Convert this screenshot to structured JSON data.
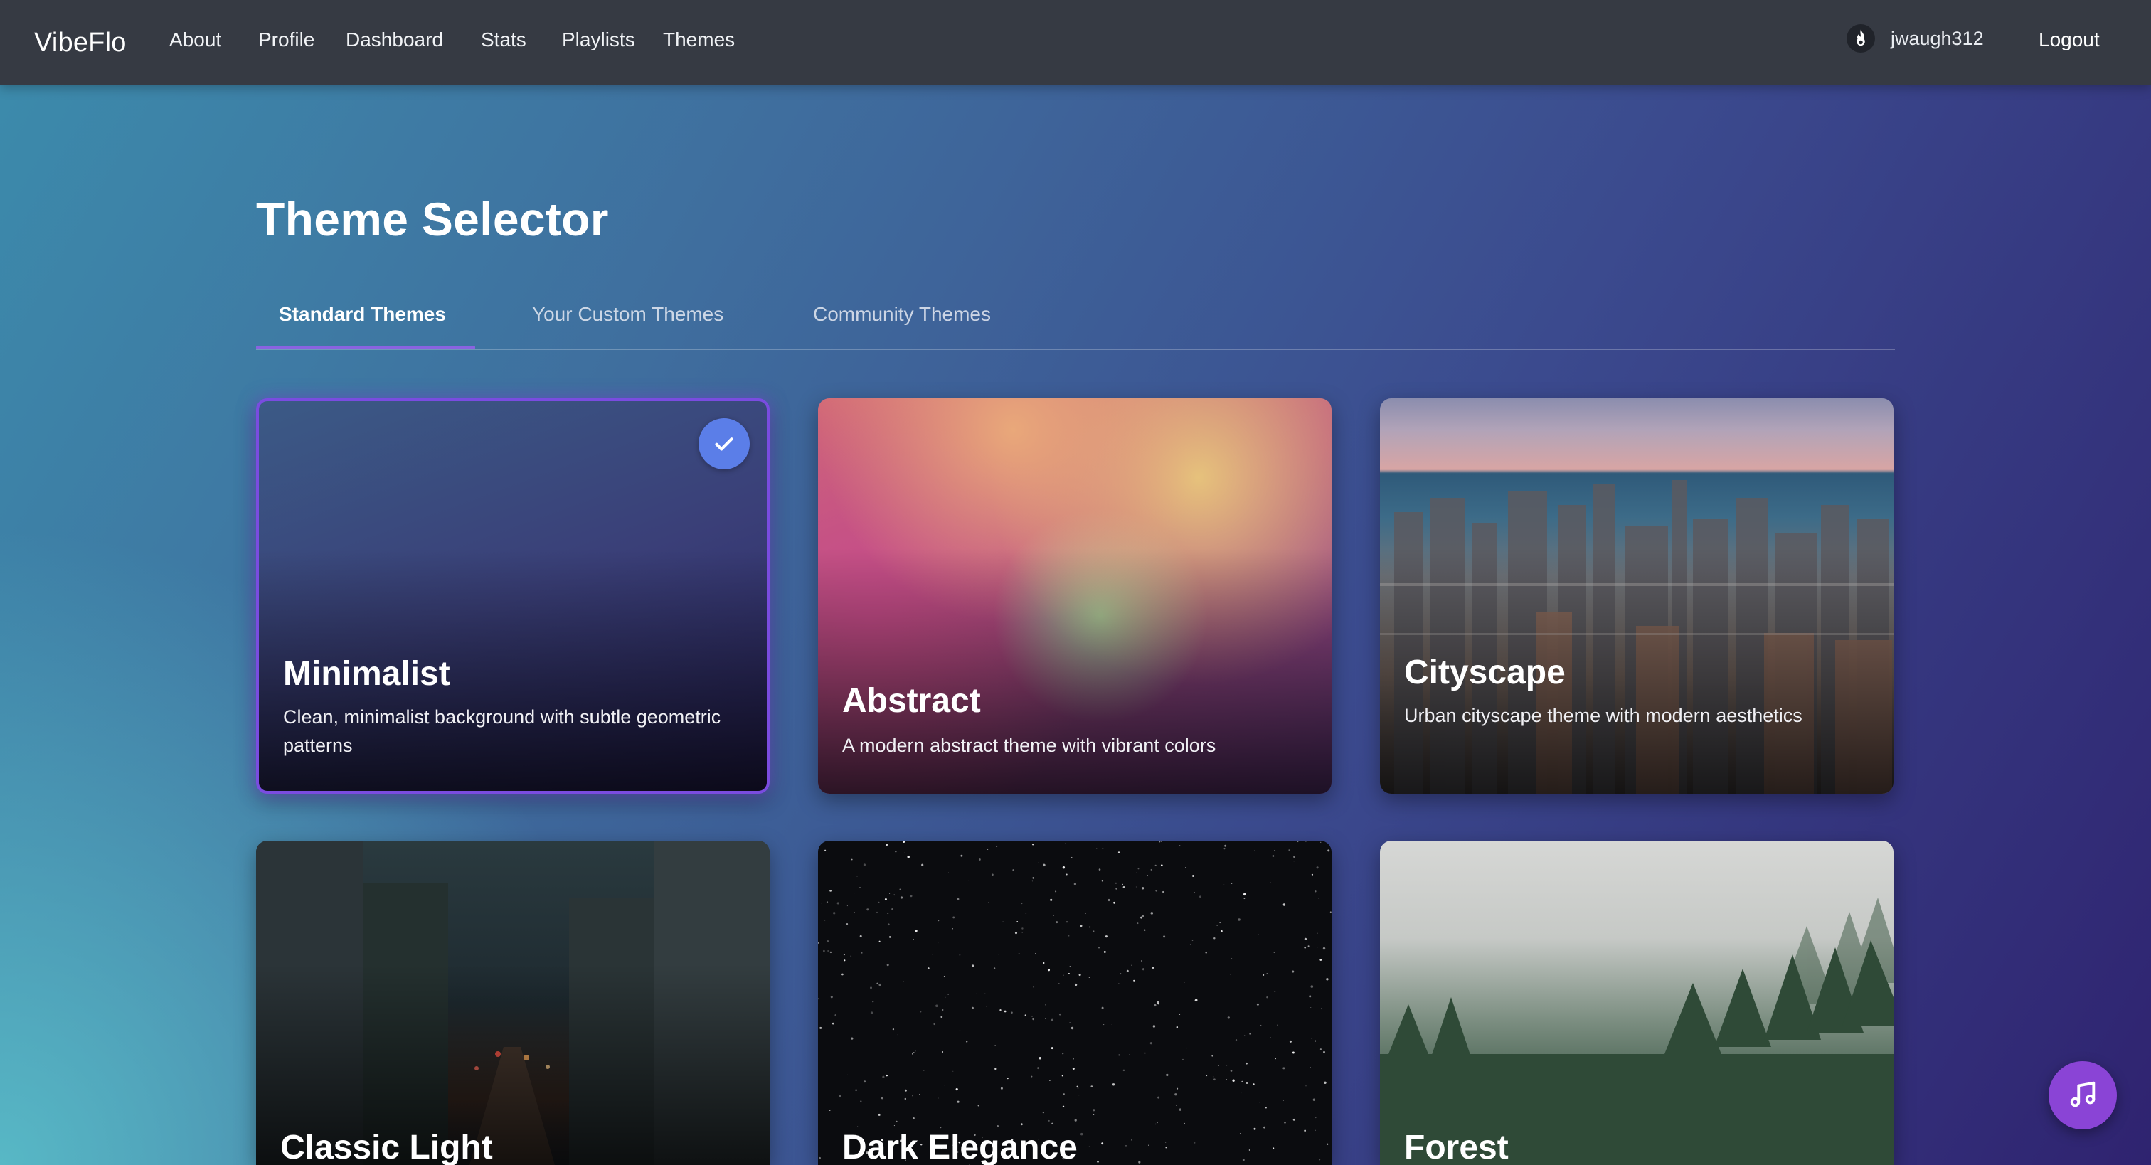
{
  "nav": {
    "brand": "VibeFlo",
    "links": [
      "About",
      "Profile",
      "Dashboard",
      "Stats",
      "Playlists",
      "Themes"
    ],
    "username": "jwaugh312",
    "logout": "Logout"
  },
  "page": {
    "title": "Theme Selector",
    "tabs": [
      "Standard Themes",
      "Your Custom Themes",
      "Community Themes"
    ],
    "active_tab": "Standard Themes"
  },
  "themes": [
    {
      "name": "Minimalist",
      "description": "Clean, minimalist background with subtle geometric patterns",
      "selected": true
    },
    {
      "name": "Abstract",
      "description": "A modern abstract theme with vibrant colors",
      "selected": false
    },
    {
      "name": "Cityscape",
      "description": "Urban cityscape theme with modern aesthetics",
      "selected": false
    },
    {
      "name": "Classic Light",
      "description": "",
      "selected": false
    },
    {
      "name": "Dark Elegance",
      "description": "",
      "selected": false
    },
    {
      "name": "Forest",
      "description": "",
      "selected": false
    }
  ],
  "icons": {
    "user": "flame-icon",
    "selected": "checkmark-icon",
    "music_player": "music-note-icon"
  },
  "colors": {
    "accent": "#8a63e0",
    "check_badge": "#5b7ee8",
    "fab": "#8a44d6",
    "navbar": "#363a43"
  }
}
